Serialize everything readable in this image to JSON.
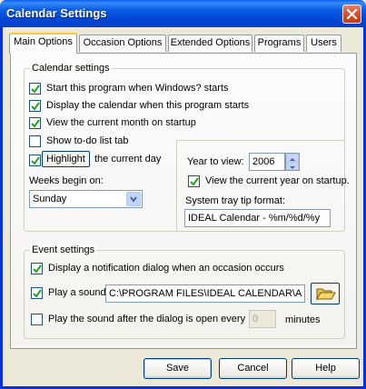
{
  "window": {
    "title": "Calendar Settings"
  },
  "tabs": [
    {
      "label": "Main Options",
      "active": true
    },
    {
      "label": "Occasion Options",
      "active": false
    },
    {
      "label": "Extended Options",
      "active": false
    },
    {
      "label": "Programs",
      "active": false
    },
    {
      "label": "Users",
      "active": false
    }
  ],
  "calendar_settings": {
    "group_label": "Calendar settings",
    "start_with_windows": {
      "label": "Start this program when Windows? starts",
      "checked": true
    },
    "display_calendar": {
      "label": "Display the calendar when this program starts",
      "checked": true
    },
    "view_current_month": {
      "label": "View the current month on startup",
      "checked": true
    },
    "show_todo_tab": {
      "label": "Show to-do list tab",
      "checked": false
    },
    "highlight_day": {
      "button_label": "Highlight",
      "suffix": "the current day",
      "checked": true
    },
    "weeks_begin_label": "Weeks begin on:",
    "weeks_begin_value": "Sunday",
    "year_to_view_label": "Year to view:",
    "year_to_view_value": "2006",
    "view_current_year": {
      "label": "View the current year on startup.",
      "checked": true
    },
    "tray_tip_label": "System tray tip format:",
    "tray_tip_value": "IDEAL Calendar - %m/%d/%y"
  },
  "event_settings": {
    "group_label": "Event settings",
    "notification_dialog": {
      "label": "Display a notification dialog when an occasion occurs",
      "checked": true
    },
    "play_sound": {
      "label": "Play a sound",
      "checked": true,
      "path": "C:\\PROGRAM FILES\\IDEAL CALENDAR\\A"
    },
    "repeat_sound": {
      "label": "Play the sound after the dialog is open every",
      "checked": false,
      "value": "0",
      "unit": "minutes"
    }
  },
  "buttons": {
    "save": "Save",
    "cancel": "Cancel",
    "help": "Help"
  }
}
